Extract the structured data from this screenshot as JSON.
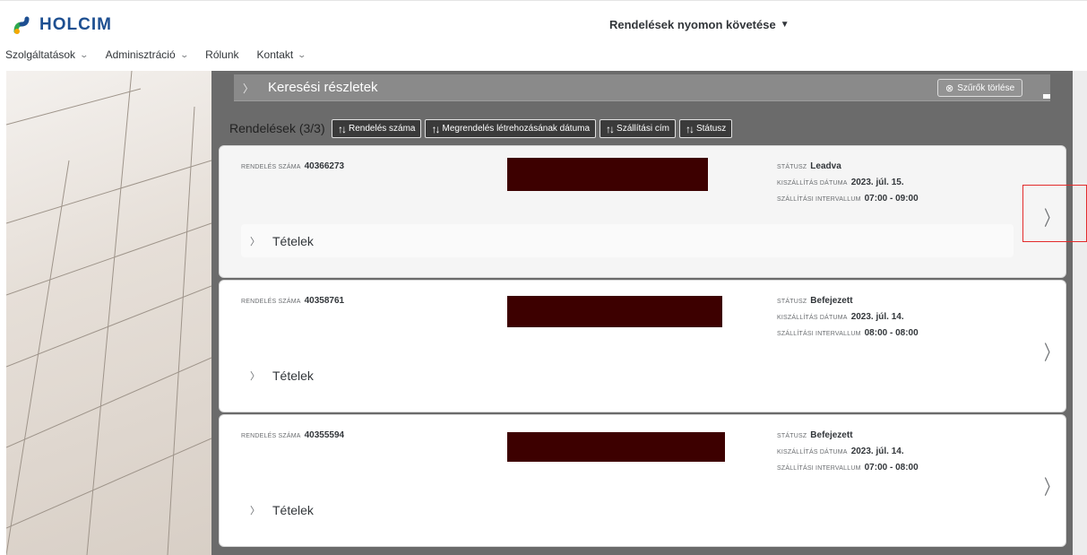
{
  "header": {
    "logo_text": "HOLCIM",
    "page_title": "Rendelések nyomon követése",
    "page_title_caret": "▼"
  },
  "nav": {
    "items": [
      {
        "label": "Szolgáltatások",
        "has_dropdown": true
      },
      {
        "label": "Adminisztráció",
        "has_dropdown": true
      },
      {
        "label": "Rólunk",
        "has_dropdown": false
      },
      {
        "label": "Kontakt",
        "has_dropdown": true
      }
    ]
  },
  "search": {
    "label": "Keresési részletek",
    "clear_filters": "Szűrők törlése"
  },
  "orders": {
    "title": "Rendelések (3/3)",
    "sort_buttons": [
      "Rendelés száma",
      "Megrendelés létrehozásának dátuma",
      "Szállítási cím",
      "Státusz"
    ],
    "labels": {
      "order_number": "RENDELÉS SZÁMA",
      "status": "STÁTUSZ",
      "delivery_date": "KISZÁLLÍTÁS DÁTUMA",
      "delivery_interval": "SZÁLLÍTÁSI INTERVALLUM",
      "items": "Tételek"
    },
    "list": [
      {
        "number": "40366273",
        "status": "Leadva",
        "delivery_date": "2023. júl. 15.",
        "interval": "07:00 - 09:00"
      },
      {
        "number": "40358761",
        "status": "Befejezett",
        "delivery_date": "2023. júl. 14.",
        "interval": "08:00 - 08:00"
      },
      {
        "number": "40355594",
        "status": "Befejezett",
        "delivery_date": "2023. júl. 14.",
        "interval": "07:00 - 08:00"
      }
    ]
  },
  "colors": {
    "brand": "#1d4f91",
    "redaction": "#3d0000",
    "highlight": "#e32b2b"
  }
}
